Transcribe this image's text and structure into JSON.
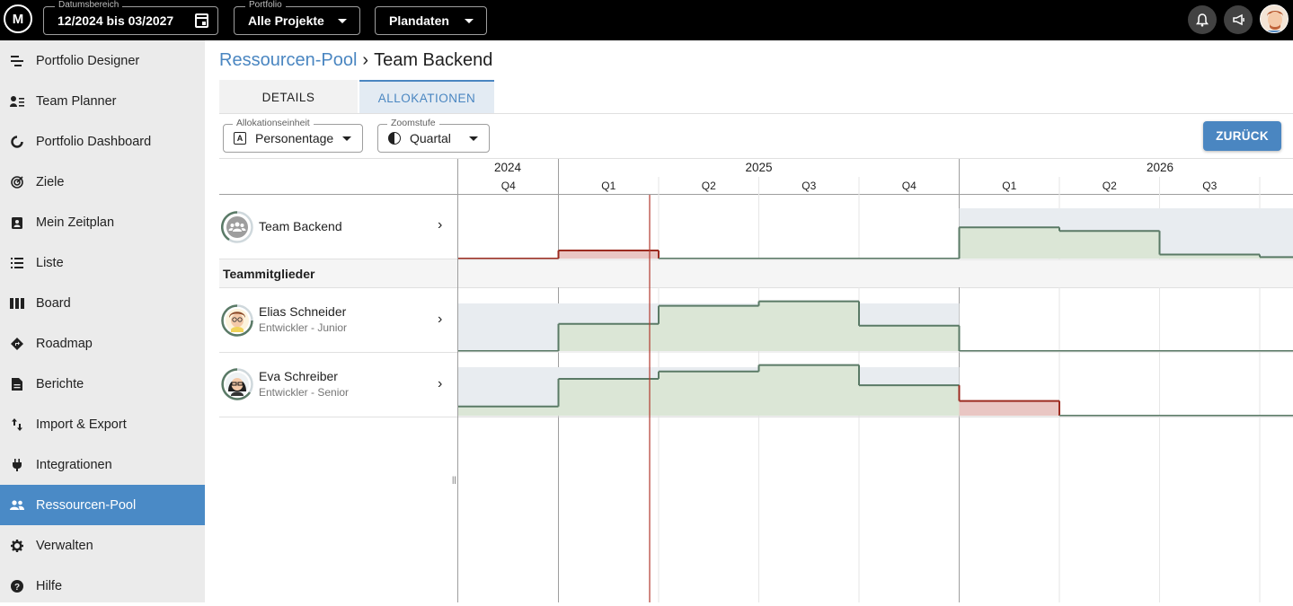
{
  "topbar": {
    "logo_text": "M",
    "date_range": {
      "label": "Datumsbereich",
      "value": "12/2024 bis 03/2027"
    },
    "portfolio": {
      "label": "Portfolio",
      "value": "Alle Projekte"
    },
    "data_source": {
      "value": "Plandaten"
    },
    "icons": [
      "bell-icon",
      "megaphone-icon",
      "user-avatar"
    ]
  },
  "sidebar": {
    "items": [
      {
        "label": "Portfolio Designer",
        "icon": "portfolio-designer-icon"
      },
      {
        "label": "Team Planner",
        "icon": "team-planner-icon"
      },
      {
        "label": "Portfolio Dashboard",
        "icon": "dashboard-icon"
      },
      {
        "label": "Ziele",
        "icon": "goals-icon"
      },
      {
        "label": "Mein Zeitplan",
        "icon": "schedule-icon"
      },
      {
        "label": "Liste",
        "icon": "list-icon"
      },
      {
        "label": "Board",
        "icon": "board-icon"
      },
      {
        "label": "Roadmap",
        "icon": "roadmap-icon"
      },
      {
        "label": "Berichte",
        "icon": "report-icon"
      },
      {
        "label": "Import & Export",
        "icon": "import-export-icon"
      },
      {
        "label": "Integrationen",
        "icon": "plug-icon"
      },
      {
        "label": "Ressourcen-Pool",
        "icon": "people-icon",
        "active": true
      },
      {
        "label": "Verwalten",
        "icon": "gear-icon"
      },
      {
        "label": "Hilfe",
        "icon": "help-icon"
      }
    ]
  },
  "breadcrumb": {
    "parent": "Ressourcen-Pool",
    "separator": "›",
    "current": "Team Backend"
  },
  "tabs": [
    {
      "label": "DETAILS",
      "active": false
    },
    {
      "label": "ALLOKATIONEN",
      "active": true
    }
  ],
  "controls": {
    "allocation_unit": {
      "label": "Allokationseinheit",
      "value": "Personentage",
      "icon_glyph": "A"
    },
    "zoom": {
      "label": "Zoomstufe",
      "value": "Quartal"
    },
    "back_button": "ZURÜCK"
  },
  "timeline": {
    "years": [
      "2024",
      "2025",
      "2026"
    ],
    "quarters": [
      "Q4",
      "Q1",
      "Q2",
      "Q3",
      "Q4",
      "Q1",
      "Q2",
      "Q3"
    ],
    "today_marker": "2025-Q1 (late)"
  },
  "team": {
    "name": "Team Backend",
    "chevron": "›"
  },
  "section": {
    "title": "Teammitglieder"
  },
  "members": [
    {
      "name": "Elias Schneider",
      "role": "Entwickler - Junior"
    },
    {
      "name": "Eva Schreiber",
      "role": "Entwickler - Senior"
    }
  ],
  "chart_data": {
    "type": "area",
    "step": true,
    "x": [
      "2024-Q4",
      "2025-Q1",
      "2025-Q2",
      "2025-Q3",
      "2025-Q4",
      "2026-Q1",
      "2026-Q2",
      "2026-Q3",
      "2026-Q4"
    ],
    "units": "fraction of capacity",
    "series": [
      {
        "row": "Team Backend",
        "capacity": [
          0,
          0,
          0,
          0,
          0,
          1.0,
          1.0,
          1.0,
          1.0
        ],
        "allocation": [
          0,
          0.16,
          0,
          0,
          0,
          0.62,
          0.55,
          0.08,
          0.03
        ],
        "overallocated": [
          true,
          true,
          false,
          false,
          false,
          false,
          false,
          false,
          false
        ]
      },
      {
        "row": "Elias Schneider",
        "capacity": [
          1.0,
          1.0,
          1.0,
          1.0,
          1.0,
          0,
          0,
          0,
          0
        ],
        "allocation": [
          0,
          0.6,
          1.0,
          1.1,
          0.56,
          0,
          0,
          0,
          0
        ],
        "overallocated": [
          false,
          false,
          false,
          false,
          false,
          false,
          false,
          false,
          false
        ]
      },
      {
        "row": "Eva Schreiber",
        "capacity": [
          1.0,
          1.0,
          1.0,
          1.0,
          1.0,
          0,
          0,
          0,
          0
        ],
        "allocation": [
          0.2,
          0.8,
          0.96,
          1.1,
          0.66,
          0.32,
          0,
          0,
          0
        ],
        "overallocated": [
          false,
          false,
          false,
          false,
          false,
          true,
          false,
          false,
          false
        ]
      }
    ],
    "colors": {
      "capacity": "#e8ecf0",
      "allocation": "#dbe6d6",
      "allocation_line": "#5a7a66",
      "over": "#e9c6c3",
      "over_line": "#9c2b20"
    }
  }
}
